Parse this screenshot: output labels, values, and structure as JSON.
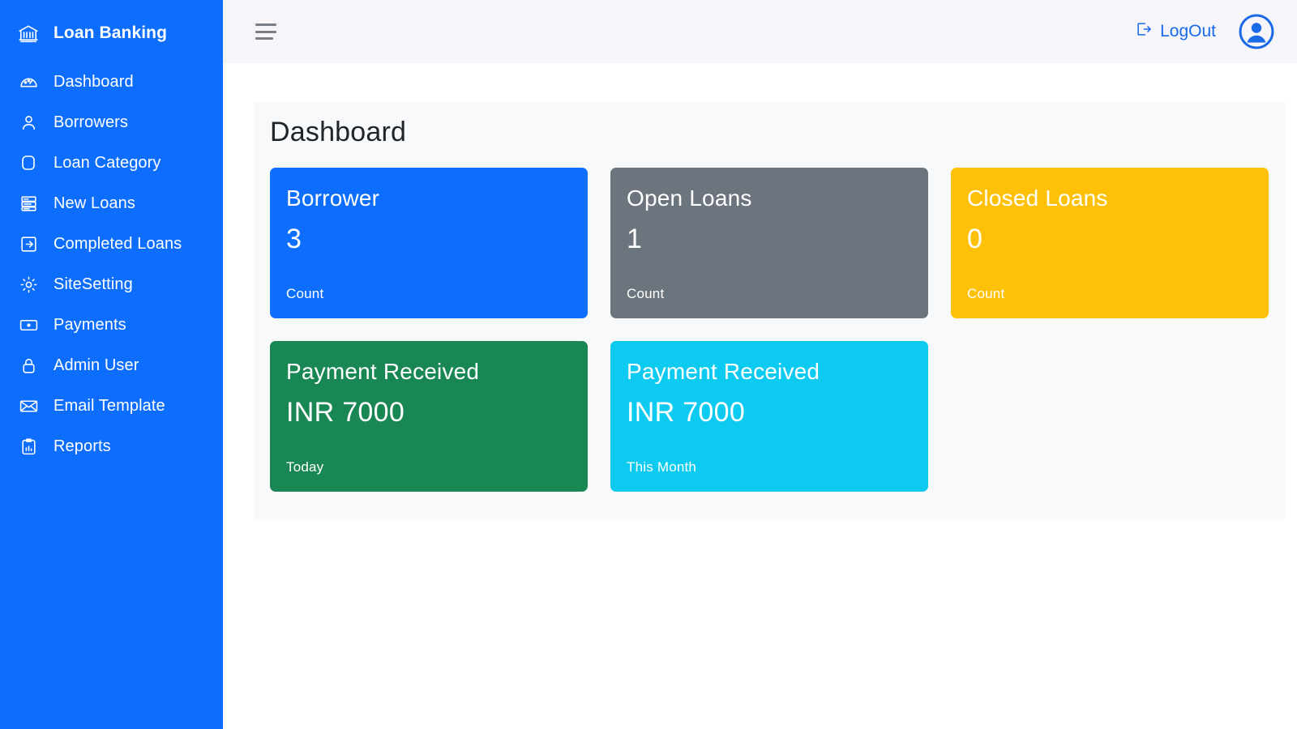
{
  "sidebar": {
    "brand": {
      "label": "Loan Banking",
      "icon": "bank-icon"
    },
    "items": [
      {
        "label": "Dashboard",
        "icon": "speedometer-icon"
      },
      {
        "label": "Borrowers",
        "icon": "person-icon"
      },
      {
        "label": "Loan Category",
        "icon": "rounded-square-icon"
      },
      {
        "label": "New Loans",
        "icon": "server-stack-icon"
      },
      {
        "label": "Completed Loans",
        "icon": "box-arrow-right-icon"
      },
      {
        "label": "SiteSetting",
        "icon": "gear-icon"
      },
      {
        "label": "Payments",
        "icon": "cash-icon"
      },
      {
        "label": "Admin User",
        "icon": "lock-icon"
      },
      {
        "label": "Email Template",
        "icon": "envelope-icon"
      },
      {
        "label": "Reports",
        "icon": "clipboard-chart-icon"
      }
    ]
  },
  "topbar": {
    "menu_toggle": "hamburger-icon",
    "logout_label": "LogOut",
    "logout_icon": "box-arrow-right-icon",
    "avatar_icon": "user-circle-icon"
  },
  "page": {
    "title": "Dashboard"
  },
  "cards": [
    {
      "title": "Borrower",
      "value": "3",
      "footer": "Count",
      "color": "#0d6efd"
    },
    {
      "title": "Open Loans",
      "value": "1",
      "footer": "Count",
      "color": "#6c757d"
    },
    {
      "title": "Closed Loans",
      "value": "0",
      "footer": "Count",
      "color": "#ffc107"
    },
    {
      "title": "Payment Received",
      "value": "INR 7000",
      "footer": "Today",
      "color": "#198754"
    },
    {
      "title": "Payment Received",
      "value": "INR 7000",
      "footer": "This Month",
      "color": "#0dcaf0"
    }
  ],
  "colors": {
    "sidebar": "#0d6efd",
    "topbar": "#f5f5fa",
    "panel": "#f8f9fa",
    "accent": "#1a6ae8"
  }
}
